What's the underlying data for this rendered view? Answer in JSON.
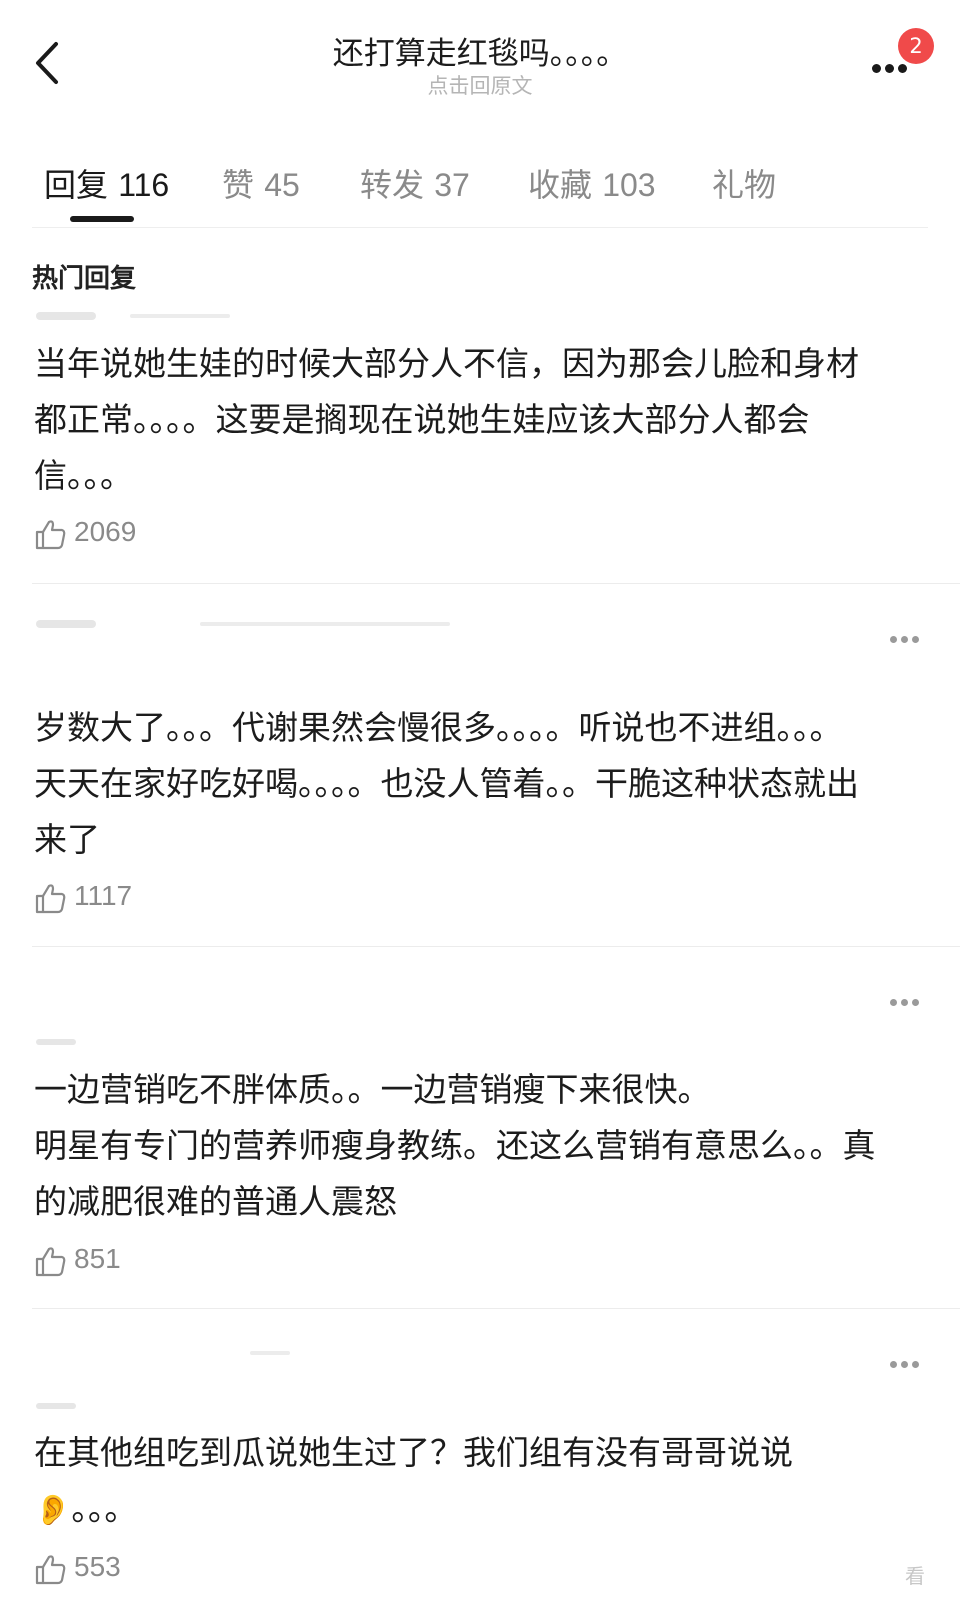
{
  "header": {
    "title": "还打算走红毯吗。。。。",
    "subtitle": "点击回原文",
    "badge_count": "2"
  },
  "tabs": [
    {
      "label": "回复",
      "count": "116",
      "active": true
    },
    {
      "label": "赞",
      "count": "45"
    },
    {
      "label": "转发",
      "count": "37"
    },
    {
      "label": "收藏",
      "count": "103"
    },
    {
      "label": "礼物",
      "count": ""
    }
  ],
  "section_title": "热门回复",
  "comments": [
    {
      "text": "当年说她生娃的时候大部分人不信，因为那会儿脸和身材\n都正常。。。。这要是搁现在说她生娃应该大部分人都会\n信。。。",
      "likes": "2069"
    },
    {
      "text": "岁数大了。。。代谢果然会慢很多。。。。听说也不进组。。。\n天天在家好吃好喝。。。。也没人管着。。干脆这种状态就出\n来了",
      "likes": "1117"
    },
    {
      "text": "一边营销吃不胖体质。。一边营销瘦下来很快。\n明星有专门的营养师瘦身教练。还这么营销有意思么。。真\n的减肥很难的普通人震怒",
      "likes": "851"
    },
    {
      "text": "在其他组吃到瓜说她生过了？我们组有没有哥哥说说",
      "emoji": "👂",
      "suffix": "。。。",
      "likes": "553"
    }
  ],
  "watermark": "看"
}
